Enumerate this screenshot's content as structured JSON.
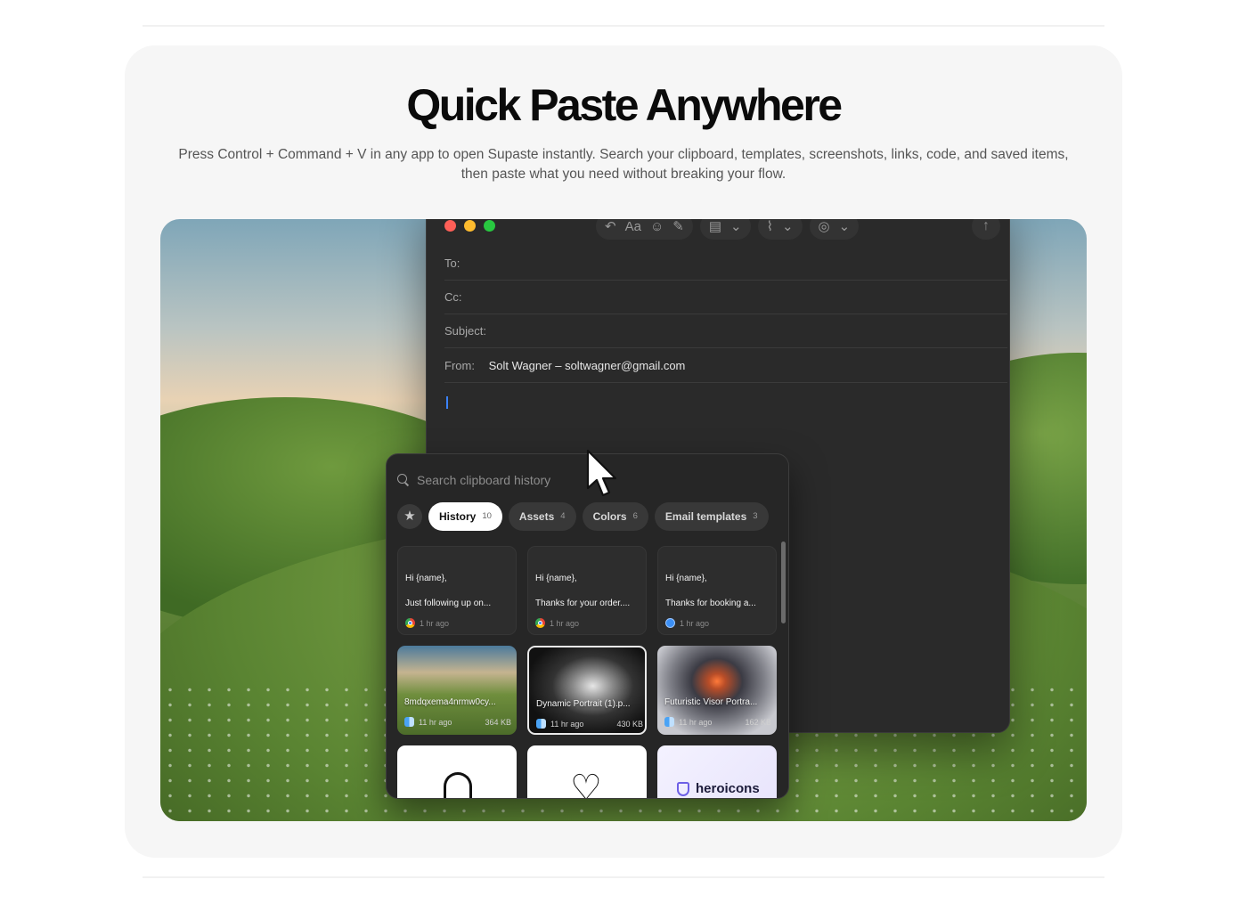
{
  "section": {
    "headline": "Quick Paste Anywhere",
    "subtext": "Press Control + Command + V in any app to open Supaste instantly. Search your clipboard, templates, screenshots, links, code, and saved items, then paste what you need without breaking your flow."
  },
  "mail": {
    "toolbar": {
      "format_label": "Aa"
    },
    "fields": {
      "to_label": "To:",
      "cc_label": "Cc:",
      "subject_label": "Subject:",
      "from_label": "From:",
      "from_value": "Solt Wagner – soltwagner@gmail.com"
    }
  },
  "clipboard": {
    "search_placeholder": "Search clipboard history",
    "tabs": [
      {
        "label": "History",
        "count": "10"
      },
      {
        "label": "Assets",
        "count": "4"
      },
      {
        "label": "Colors",
        "count": "6"
      },
      {
        "label": "Email templates",
        "count": "3"
      }
    ],
    "items": [
      {
        "line1": "Hi {name},",
        "line2": "Just following up on...",
        "time": "1 hr ago",
        "app": "chrome-icon"
      },
      {
        "line1": "Hi {name},",
        "line2": "Thanks for your order....",
        "time": "1 hr ago",
        "app": "chrome-icon"
      },
      {
        "line1": "Hi {name},",
        "line2": "Thanks for booking a...",
        "time": "1 hr ago",
        "app": "safari-icon"
      },
      {
        "title": "8mdqxema4nrmw0cy...",
        "time": "11 hr ago",
        "size": "364 KB",
        "app": "finder-icon"
      },
      {
        "title": "Dynamic Portrait (1).p...",
        "time": "11 hr ago",
        "size": "430 KB",
        "app": "finder-icon"
      },
      {
        "title": "Futuristic Visor Portra...",
        "time": "11 hr ago",
        "size": "162 KB",
        "app": "finder-icon"
      },
      {
        "icon": "bell-icon"
      },
      {
        "icon": "heart-icon"
      },
      {
        "brand": "heroicons"
      }
    ]
  },
  "colors": {
    "accent_caret": "#3b82f6",
    "active_tab_bg": "#ffffff"
  }
}
